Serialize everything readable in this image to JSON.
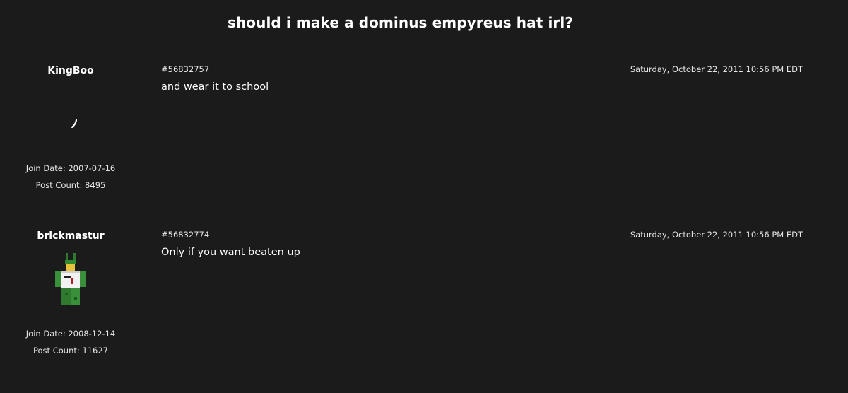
{
  "thread": {
    "title": "should i make a dominus empyreus hat irl?"
  },
  "posts": [
    {
      "author": "KingBoo",
      "avatar_icon": "broken-avatar-icon",
      "join_date": "Join Date: 2007-07-16",
      "post_count": "Post Count: 8495",
      "post_id": "#56832757",
      "date": "Saturday, October 22, 2011 10:56 PM EDT",
      "body": "and wear it to school"
    },
    {
      "author": "brickmastur",
      "avatar_icon": "character-avatar-icon",
      "join_date": "Join Date: 2008-12-14",
      "post_count": "Post Count: 11627",
      "post_id": "#56832774",
      "date": "Saturday, October 22, 2011 10:56 PM EDT",
      "body": "Only if you want beaten up"
    }
  ],
  "colors": {
    "background": "#1b1b1b",
    "text": "#ffffff",
    "meta_text": "#e6e6e6"
  }
}
